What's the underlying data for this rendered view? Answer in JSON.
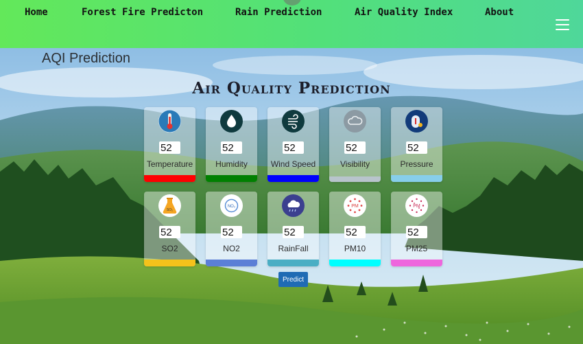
{
  "nav": {
    "items": [
      {
        "label": "Home"
      },
      {
        "label": "Forest Fire Predicton"
      },
      {
        "label": "Rain Prediction"
      },
      {
        "label": "Air Quality Index"
      },
      {
        "label": "About"
      }
    ],
    "menu_icon": "hamburger-menu-icon"
  },
  "page_title": "AQI Prediction",
  "heading": "Air Quality Prediction",
  "cards": [
    {
      "label": "Temperature",
      "value": "52",
      "icon": "thermometer-icon",
      "bar_color": "#ff0000"
    },
    {
      "label": "Humidity",
      "value": "52",
      "icon": "humidity-icon",
      "bar_color": "#008000"
    },
    {
      "label": "Wind Speed",
      "value": "52",
      "icon": "wind-icon",
      "bar_color": "#0000ff"
    },
    {
      "label": "Visibility",
      "value": "52",
      "icon": "visibility-icon",
      "bar_color": "#b8c4cc"
    },
    {
      "label": "Pressure",
      "value": "52",
      "icon": "pressure-gauge-icon",
      "bar_color": "#87ceeb"
    },
    {
      "label": "SO2",
      "value": "52",
      "icon": "so2-flask-icon",
      "bar_color": "#f5c21b"
    },
    {
      "label": "NO2",
      "value": "52",
      "icon": "no2-icon",
      "bar_color": "#5b7fd6"
    },
    {
      "label": "RainFall",
      "value": "52",
      "icon": "rain-cloud-icon",
      "bar_color": "#4aaec4"
    },
    {
      "label": "PM10",
      "value": "52",
      "icon": "pm10-particles-icon",
      "bar_color": "#00ffff"
    },
    {
      "label": "PM25",
      "value": "52",
      "icon": "pm25-particles-icon",
      "bar_color": "#ee66dd"
    }
  ],
  "icon_text": {
    "so2": "SO₂",
    "no2": "NO₂",
    "pm": "PM"
  },
  "predict_button": "Predict"
}
